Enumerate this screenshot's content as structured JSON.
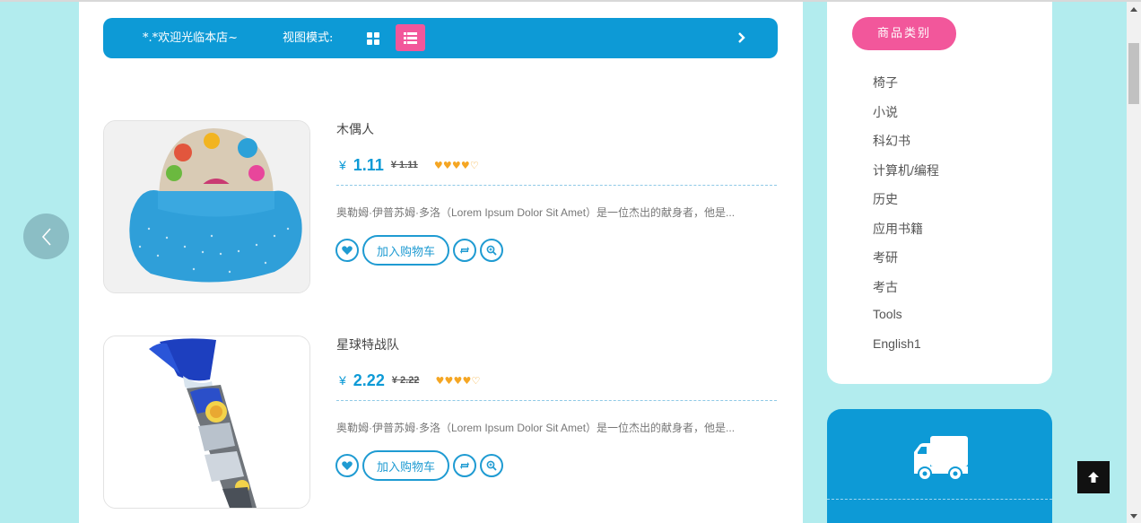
{
  "toolbar": {
    "welcome": "*.*欢迎光临本店~",
    "view_mode_label": "视图模式:"
  },
  "products": [
    {
      "name": "木偶人",
      "currency": "¥",
      "price": "1.11",
      "old_price": "¥ 1.11",
      "rating": 4,
      "rating_max": 5,
      "description": "奥勒姆·伊普苏姆·多洛（Lorem Ipsum Dolor Sit Amet）是一位杰出的献身者，他是...",
      "add_to_cart": "加入购物车",
      "image": "bucket-hat-image"
    },
    {
      "name": "星球特战队",
      "currency": "¥",
      "price": "2.22",
      "old_price": "¥ 2.22",
      "rating": 4,
      "rating_max": 5,
      "description": "奥勒姆·伊普苏姆·多洛（Lorem Ipsum Dolor Sit Amet）是一位杰出的献身者，他是...",
      "add_to_cart": "加入购物车",
      "image": "gift-cone-image"
    }
  ],
  "sidebar": {
    "title": "商品类别",
    "categories": [
      "椅子",
      "小说",
      "科幻书",
      "计算机/编程",
      "历史",
      "应用书籍",
      "考研",
      "考古",
      "Tools",
      "English1"
    ]
  },
  "icons": {
    "grid": "grid-view-icon",
    "list": "list-view-icon",
    "next": "chevron-right-icon",
    "prev": "chevron-left-icon",
    "wishlist": "heart-icon",
    "compare": "repeat-icon",
    "quickview": "zoom-icon",
    "shipping": "truck-icon",
    "back_to_top": "arrow-up-icon"
  },
  "colors": {
    "primary": "#0d9ad6",
    "accent": "#f2579b",
    "background": "#b2ecee",
    "star": "#f5a623"
  }
}
